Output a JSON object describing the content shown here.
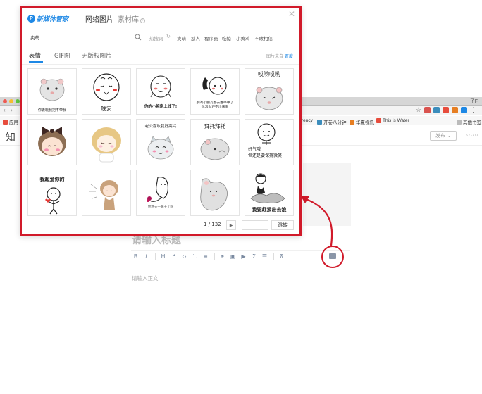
{
  "browser": {
    "profile_name": "子F",
    "bookmarks": [
      {
        "label": "应用",
        "icon": "apps-grid-icon"
      },
      {
        "label": "rency",
        "icon": ""
      },
      {
        "label": "开卷八分钟",
        "icon": "video-icon"
      },
      {
        "label": "华夏视讯",
        "icon": "hx-icon"
      },
      {
        "label": "This is Water",
        "icon": "water-icon"
      },
      {
        "label": "其他书签",
        "icon": "folder-icon"
      }
    ],
    "colors": {
      "brand_blue": "#1e88e5",
      "highlight_red": "#d11a2a"
    }
  },
  "editor": {
    "site_logo": "知",
    "publish_label": "发布",
    "more_label": "○○○",
    "title_placeholder": "请输入标题",
    "body_placeholder": "请输入正文",
    "toolbar_icons": [
      "bold-icon",
      "italic-icon",
      "heading-icon",
      "quote-icon",
      "code-icon",
      "ordered-list-icon",
      "unordered-list-icon",
      "link-icon",
      "image-icon",
      "video-icon",
      "formula-icon",
      "divider-icon",
      "clear-format-icon",
      "sticker-image-icon",
      "more-icon"
    ],
    "toolbar_glyphs": [
      "B",
      "I",
      "H",
      "❝",
      "‹›",
      "⒈",
      "≡",
      "⚭",
      "▣",
      "▶",
      "Σ",
      "☰",
      "⊼"
    ]
  },
  "popup": {
    "brand_name": "新媒体管家",
    "brand_icon_letter": "P",
    "tabs": [
      "网络图片",
      "素材库"
    ],
    "help_glyph": "?",
    "close_glyph": "✕",
    "search": {
      "value": "卖萌",
      "placeholder": ""
    },
    "hot_label": "热搜词",
    "hot_tags": [
      "卖萌",
      "怼人",
      "程序员",
      "吃惊",
      "小黄鸡",
      "不敢相信"
    ],
    "sub_tabs": [
      "表情",
      "GIF图",
      "无版权图片"
    ],
    "source_label": "图片来自",
    "source_link": "百度",
    "stickers": [
      {
        "caption": "你去玩我把不带我",
        "kind": "hamster"
      },
      {
        "caption": "晚安",
        "kind": "face-blush"
      },
      {
        "caption": "你的小祖宗上线了!",
        "kind": "face-smug"
      },
      {
        "caption": "别的小朋友都去推串串了\n你怎么还不出来啊",
        "kind": "phone"
      },
      {
        "caption": "哎哟哎哟",
        "kind": "hamster-head"
      },
      {
        "caption": "",
        "kind": "girl-bow"
      },
      {
        "caption": "",
        "kind": "girl-curly"
      },
      {
        "caption": "老公喜欢我好高兴",
        "kind": "cat-happy"
      },
      {
        "caption": "拜托拜托",
        "kind": "hamster-plead"
      },
      {
        "caption": "好气哦\n但还是要保持微笑",
        "kind": "face-smile"
      },
      {
        "caption": "我超爱你的",
        "kind": "stick-heart"
      },
      {
        "caption": "",
        "kind": "girl-dance"
      },
      {
        "caption": "你两天干嘛干了呢",
        "kind": "ghost-flower"
      },
      {
        "caption": "",
        "kind": "hamster-lie"
      },
      {
        "caption": "我要赶紧出去浪",
        "kind": "surfer"
      }
    ],
    "pager": {
      "current": "1",
      "total": "132",
      "next_glyph": "▶",
      "jump_label": "跳转"
    }
  }
}
